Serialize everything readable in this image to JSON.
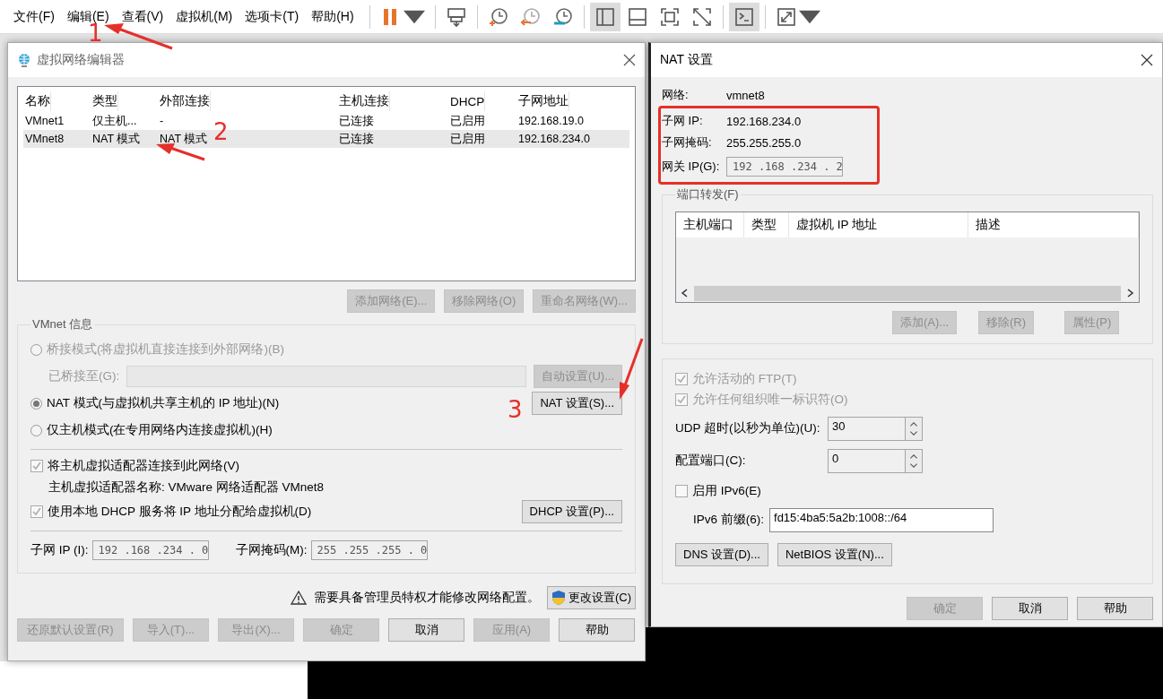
{
  "menu": [
    "文件(F)",
    "编辑(E)",
    "查看(V)",
    "虚拟机(M)",
    "选项卡(T)",
    "帮助(H)"
  ],
  "toolbar": [
    [
      {
        "kind": "pause",
        "dropdown": true,
        "selected": false
      }
    ],
    [
      {
        "kind": "keys",
        "dropdown": false,
        "selected": false
      }
    ],
    [
      {
        "kind": "snapshot",
        "dropdown": false,
        "selected": false
      },
      {
        "kind": "revert",
        "dropdown": false,
        "selected": false
      },
      {
        "kind": "manager",
        "dropdown": false,
        "selected": false
      }
    ],
    [
      {
        "kind": "sidebar",
        "dropdown": false,
        "selected": true
      },
      {
        "kind": "panel",
        "dropdown": false,
        "selected": false
      },
      {
        "kind": "fullscreen",
        "dropdown": false,
        "selected": false
      },
      {
        "kind": "unity",
        "dropdown": false,
        "selected": false
      }
    ],
    [
      {
        "kind": "console",
        "dropdown": false,
        "selected": true
      }
    ],
    [
      {
        "kind": "stretch",
        "dropdown": true,
        "selected": false
      }
    ]
  ],
  "annotations": [
    "1",
    "2",
    "3"
  ],
  "network_editor": {
    "title": "虚拟网络编辑器",
    "columns": [
      "名称",
      "类型",
      "外部连接",
      "主机连接",
      "DHCP",
      "子网地址"
    ],
    "rows": [
      {
        "cells": [
          "VMnet1",
          "仅主机...",
          "-",
          "已连接",
          "已启用",
          "192.168.19.0"
        ],
        "selected": false
      },
      {
        "cells": [
          "VMnet8",
          "NAT 模式",
          "NAT 模式",
          "已连接",
          "已启用",
          "192.168.234.0"
        ],
        "selected": true
      }
    ],
    "list_buttons": [
      {
        "label": "添加网络(E)...",
        "disabled": true
      },
      {
        "label": "移除网络(O)",
        "disabled": true
      },
      {
        "label": "重命名网络(W)...",
        "disabled": true
      }
    ],
    "info": {
      "title": "VMnet 信息",
      "bridged": {
        "label": "桥接模式(将虚拟机直接连接到外部网络)(B)",
        "selected": false,
        "disabled": true
      },
      "bridged_to": {
        "label": "已桥接至(G):",
        "disabled": true
      },
      "auto_button": {
        "label": "自动设置(U)...",
        "disabled": true
      },
      "nat": {
        "label": "NAT 模式(与虚拟机共享主机的 IP 地址)(N)",
        "selected": true,
        "disabled": false
      },
      "nat_button": {
        "label": "NAT 设置(S)...",
        "disabled": false
      },
      "host_only": {
        "label": "仅主机模式(在专用网络内连接虚拟机)(H)",
        "selected": false,
        "disabled": false
      },
      "connect_adapter": {
        "label": "将主机虚拟适配器连接到此网络(V)",
        "checked": true
      },
      "adapter_name": "主机虚拟适配器名称: VMware 网络适配器 VMnet8",
      "dhcp": {
        "label": "使用本地 DHCP 服务将 IP 地址分配给虚拟机(D)",
        "checked": true
      },
      "dhcp_button": {
        "label": "DHCP 设置(P)...",
        "disabled": false
      },
      "subnet_ip": {
        "label": "子网 IP (I):",
        "value": "192 .168 .234 . 0"
      },
      "subnet_mask": {
        "label": "子网掩码(M):",
        "value": "255 .255 .255 . 0"
      }
    },
    "warning": "需要具备管理员特权才能修改网络配置。",
    "change_button": "更改设置(C)",
    "buttons": [
      {
        "label": "还原默认设置(R)",
        "disabled": true
      },
      {
        "label": "导入(T)...",
        "disabled": true
      },
      {
        "label": "导出(X)...",
        "disabled": true
      },
      {
        "label": "确定",
        "disabled": true
      },
      {
        "label": "取消",
        "disabled": false
      },
      {
        "label": "应用(A)",
        "disabled": true
      },
      {
        "label": "帮助",
        "disabled": false
      }
    ]
  },
  "nat_settings": {
    "title": "NAT 设置",
    "network": {
      "label": "网络:",
      "value": "vmnet8"
    },
    "subnet_ip": {
      "label": "子网 IP:",
      "value": "192.168.234.0"
    },
    "subnet_mask": {
      "label": "子网掩码:",
      "value": "255.255.255.0"
    },
    "gateway": {
      "label": "网关 IP(G):",
      "value": "192 .168 .234 . 2"
    },
    "port_forwarding": {
      "title": "端口转发(F)",
      "columns": [
        "主机端口",
        "类型",
        "虚拟机 IP 地址",
        "描述"
      ],
      "buttons": [
        {
          "label": "添加(A)...",
          "disabled": true
        },
        {
          "label": "移除(R)",
          "disabled": true
        },
        {
          "label": "属性(P)",
          "disabled": true
        }
      ]
    },
    "options": {
      "checkboxes": [
        {
          "label": "允许活动的 FTP(T)",
          "checked": true,
          "disabled": true
        },
        {
          "label": "允许任何组织唯一标识符(O)",
          "checked": true,
          "disabled": true
        }
      ],
      "udp_timeout": {
        "label": "UDP 超时(以秒为单位)(U):",
        "value": "30"
      },
      "config_port": {
        "label": "配置端口(C):",
        "value": "0"
      },
      "ipv6": {
        "label": "启用 IPv6(E)",
        "checked": false,
        "disabled": false
      },
      "ipv6_prefix": {
        "label": "IPv6 前缀(6):",
        "value": "fd15:4ba5:5a2b:1008::/64"
      },
      "buttons": [
        {
          "label": "DNS 设置(D)...",
          "disabled": false
        },
        {
          "label": "NetBIOS 设置(N)...",
          "disabled": false
        }
      ]
    },
    "buttons": [
      {
        "label": "确定",
        "disabled": true
      },
      {
        "label": "取消",
        "disabled": false
      },
      {
        "label": "帮助",
        "disabled": false
      }
    ]
  }
}
